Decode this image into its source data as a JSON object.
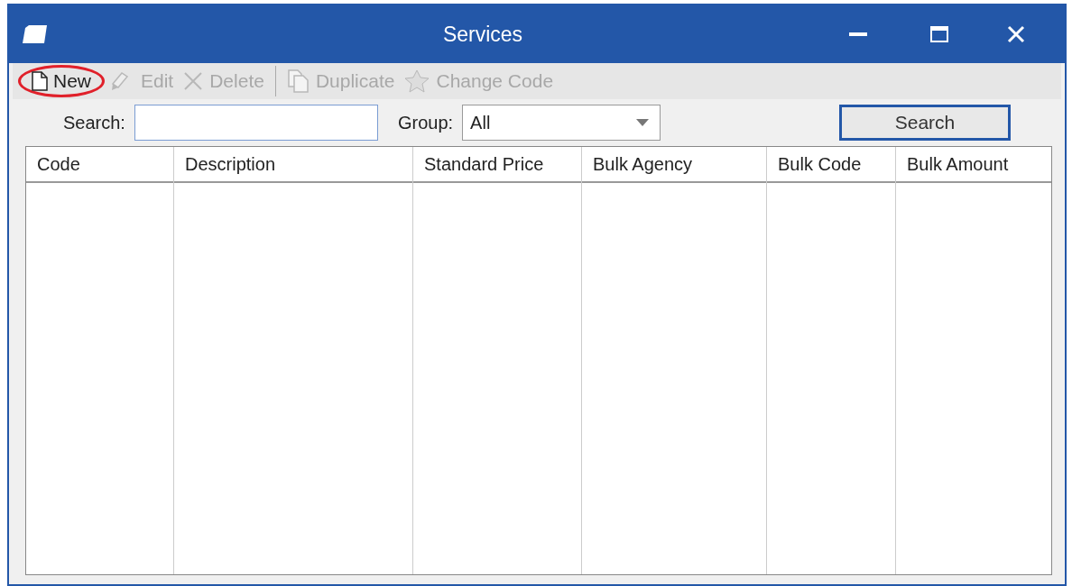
{
  "window": {
    "title": "Services"
  },
  "toolbar": [
    {
      "kind": "button",
      "label": "New",
      "disabled": false,
      "annotated": true
    },
    {
      "kind": "button",
      "label": "Edit",
      "disabled": true,
      "annotated": false
    },
    {
      "kind": "button",
      "label": "Delete",
      "disabled": true,
      "annotated": false
    },
    {
      "kind": "separator"
    },
    {
      "kind": "button",
      "label": "Duplicate",
      "disabled": true,
      "annotated": false
    },
    {
      "kind": "button",
      "label": "Change Code",
      "disabled": true,
      "annotated": false
    }
  ],
  "filters": {
    "search_label": "Search:",
    "group_label": "Group:",
    "group_value": "All",
    "search_button": "Search"
  },
  "table": {
    "columns": [
      "Code",
      "Description",
      "Standard Price",
      "Bulk Agency",
      "Bulk Code",
      "Bulk Amount"
    ]
  }
}
